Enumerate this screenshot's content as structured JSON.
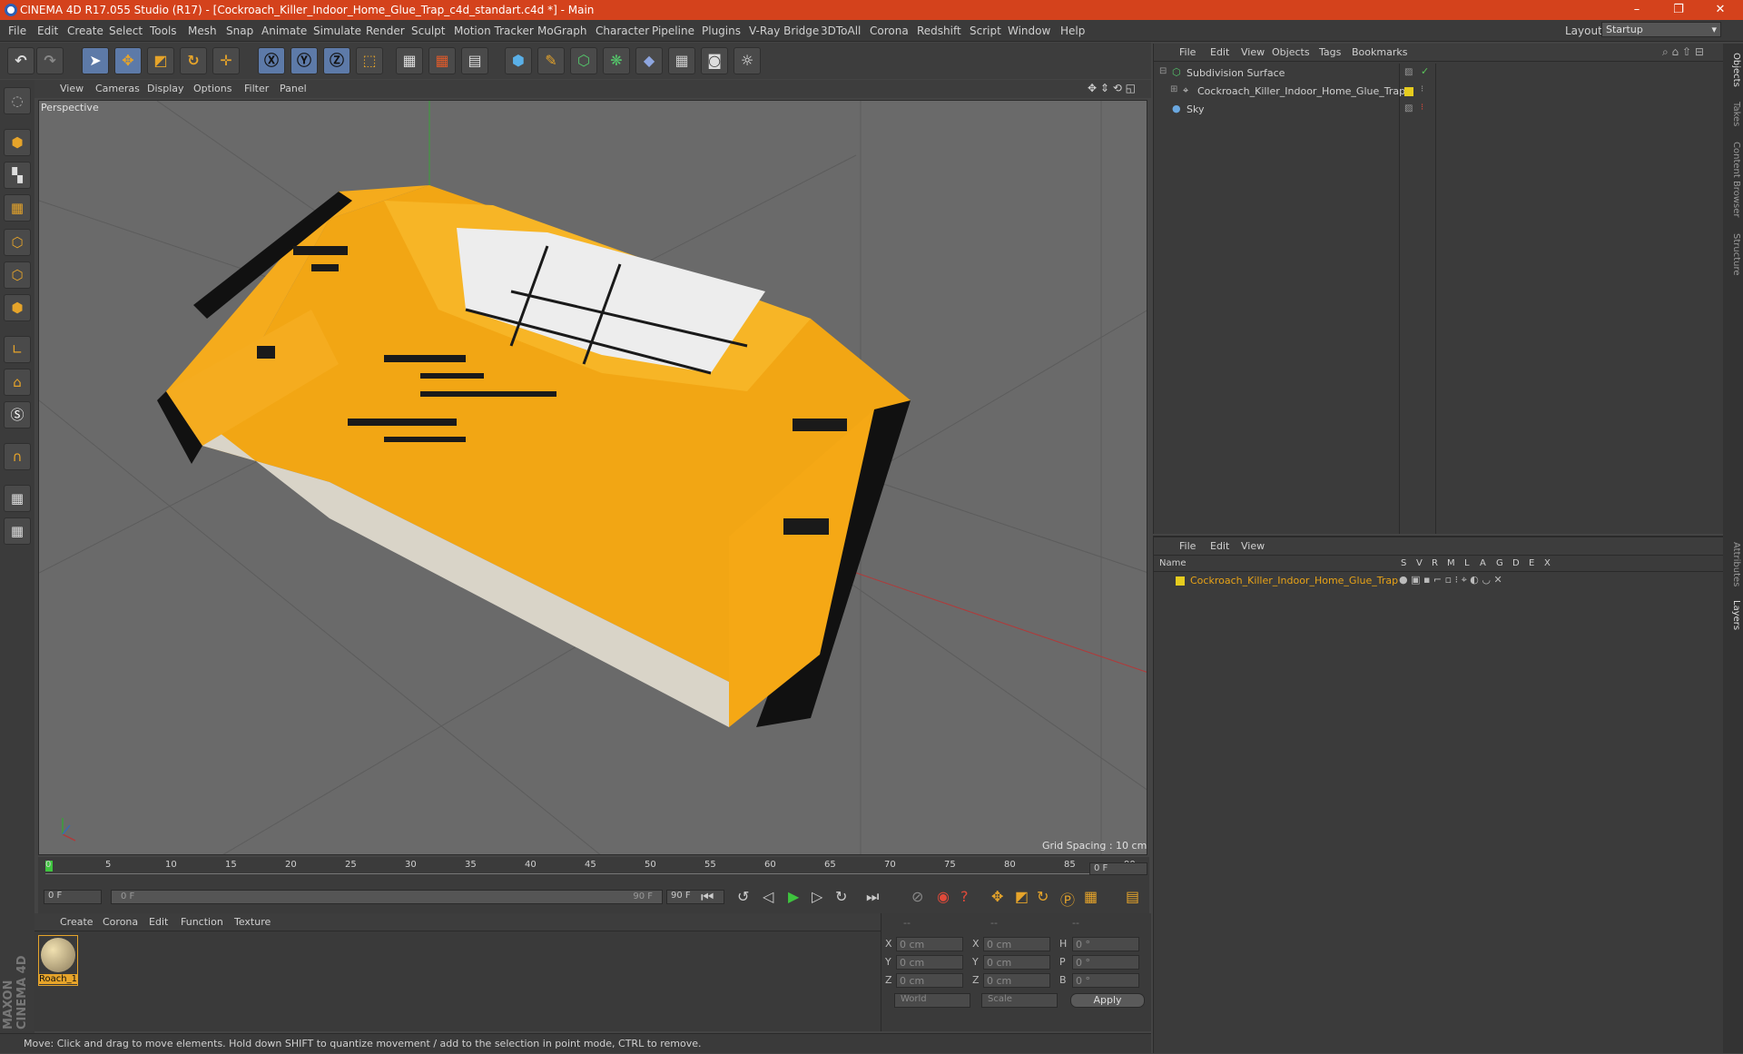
{
  "window": {
    "title": "CINEMA 4D R17.055 Studio (R17) - [Cockroach_Killer_Indoor_Home_Glue_Trap_c4d_standart.c4d *] - Main",
    "controls": [
      "–",
      "❐",
      "✕"
    ]
  },
  "menu": [
    "File",
    "Edit",
    "Create",
    "Select",
    "Tools",
    "Mesh",
    "Snap",
    "Animate",
    "Simulate",
    "Render",
    "Sculpt",
    "Motion Tracker",
    "MoGraph",
    "Character",
    "Pipeline",
    "Plugins",
    "V-Ray Bridge",
    "3DToAll",
    "Corona",
    "Redshift",
    "Script",
    "Window",
    "Help"
  ],
  "layout": {
    "label": "Layout:",
    "value": "Startup"
  },
  "viewport": {
    "menu": [
      "View",
      "Cameras",
      "Display",
      "Options",
      "Filter",
      "Panel"
    ],
    "camera_label": "Perspective",
    "grid_spacing": "Grid Spacing : 10 cm"
  },
  "timeline": {
    "ticks": [
      "0",
      "5",
      "10",
      "15",
      "20",
      "25",
      "30",
      "35",
      "40",
      "45",
      "50",
      "55",
      "60",
      "65",
      "70",
      "75",
      "80",
      "85",
      "90"
    ],
    "current_frame": "0 F",
    "start_field": "0 F",
    "range_start": "0 F",
    "range_end": "90 F",
    "end_field": "90 F"
  },
  "material_manager": {
    "menu": [
      "Create",
      "Corona",
      "Edit",
      "Function",
      "Texture"
    ],
    "material_name": "Roach_1"
  },
  "coords": {
    "headers": [
      "--",
      "--",
      "--"
    ],
    "rows": [
      {
        "a": "X",
        "av": "0 cm",
        "b": "X",
        "bv": "0 cm",
        "c": "H",
        "cv": "0 °"
      },
      {
        "a": "Y",
        "av": "0 cm",
        "b": "Y",
        "bv": "0 cm",
        "c": "P",
        "cv": "0 °"
      },
      {
        "a": "Z",
        "av": "0 cm",
        "b": "Z",
        "bv": "0 cm",
        "c": "B",
        "cv": "0 °"
      }
    ],
    "mode": "World",
    "type": "Scale",
    "apply": "Apply"
  },
  "status": "Move: Click and drag to move elements. Hold down SHIFT to quantize movement / add to the selection in point mode, CTRL to remove.",
  "object_manager": {
    "menu": [
      "File",
      "Edit",
      "View",
      "Objects",
      "Tags",
      "Bookmarks"
    ],
    "objects": [
      "Subdivision Surface",
      "Cockroach_Killer_Indoor_Home_Glue_Trap",
      "Sky"
    ]
  },
  "layer_manager": {
    "menu": [
      "File",
      "Edit",
      "View"
    ],
    "columns": [
      "Name",
      "S",
      "V",
      "R",
      "M",
      "L",
      "A",
      "G",
      "D",
      "E",
      "X"
    ],
    "layer": "Cockroach_Killer_Indoor_Home_Glue_Trap"
  },
  "side_tabs": [
    "Objects",
    "Takes",
    "Content Browser",
    "Structure",
    "Attributes",
    "Layers"
  ],
  "brand": "MAXON CINEMA 4D",
  "colors": {
    "accent": "#d4421c",
    "object_yellow": "#f5ab1c",
    "layer_orange": "#e8a317"
  }
}
